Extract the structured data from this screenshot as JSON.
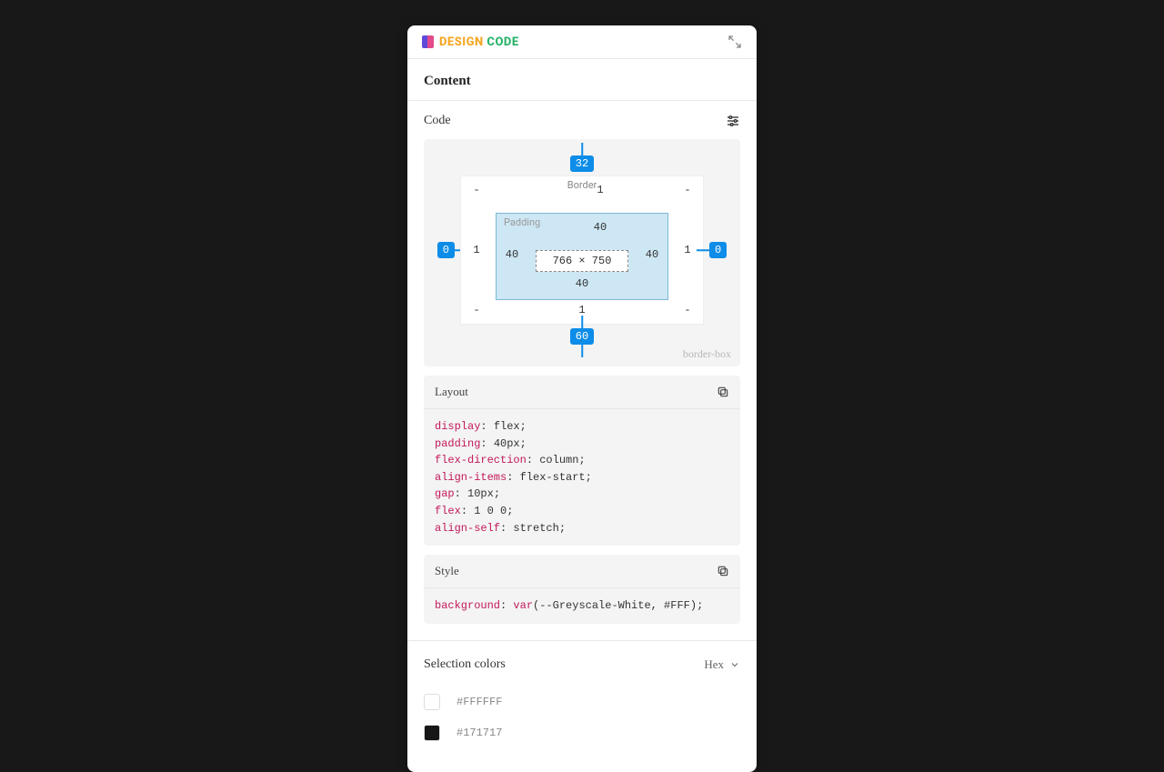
{
  "header": {
    "logo_word1": "DESIGN",
    "logo_word2": "CODE"
  },
  "section": {
    "title": "Content"
  },
  "code": {
    "title": "Code",
    "boxmodel": {
      "margin": {
        "top": "32",
        "right": "0",
        "bottom": "60",
        "left": "0"
      },
      "border_label": "Border",
      "border": {
        "top": "1",
        "right": "1",
        "bottom": "1",
        "left": "1",
        "tl": "-",
        "tr": "-",
        "bl": "-",
        "br": "-"
      },
      "padding_label": "Padding",
      "padding": {
        "top": "40",
        "right": "40",
        "bottom": "40",
        "left": "40"
      },
      "content": "766 × 750",
      "box_sizing": "border-box"
    }
  },
  "layout_block": {
    "title": "Layout",
    "lines": [
      {
        "prop": "display",
        "val": "flex"
      },
      {
        "prop": "padding",
        "val": "40px"
      },
      {
        "prop": "flex-direction",
        "val": "column"
      },
      {
        "prop": "align-items",
        "val": "flex-start"
      },
      {
        "prop": "gap",
        "val": "10px"
      },
      {
        "prop": "flex",
        "val": "1 0 0"
      },
      {
        "prop": "align-self",
        "val": "stretch"
      }
    ]
  },
  "style_block": {
    "title": "Style",
    "prop": "background",
    "func": "var",
    "args": "--Greyscale-White, #FFF"
  },
  "colors": {
    "title": "Selection colors",
    "format": "Hex",
    "items": [
      {
        "hex": "#FFFFFF",
        "swatch": "#FFFFFF"
      },
      {
        "hex": "#171717",
        "swatch": "#171717"
      }
    ]
  }
}
